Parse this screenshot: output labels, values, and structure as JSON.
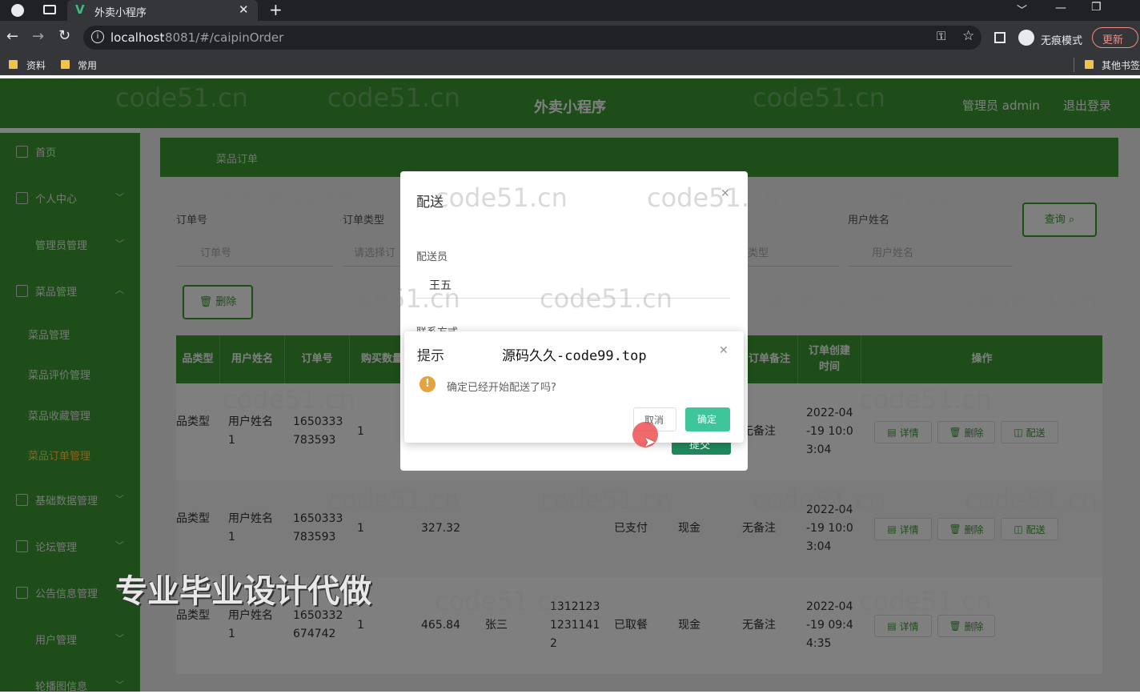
{
  "browser": {
    "tab_title": "外卖小程序",
    "new_tab_label": "+",
    "url_host": "localhost",
    "url_path": ":8081/#/caipinOrder",
    "incognito_label": "无痕模式",
    "update_label": "更新",
    "bookmarks": [
      "资料",
      "常用"
    ],
    "other_bookmarks": "其他书签"
  },
  "header": {
    "title": "外卖小程序",
    "user_label": "管理员 admin",
    "logout_label": "退出登录"
  },
  "sidebar": {
    "items": [
      {
        "label": "首页",
        "chevron": ""
      },
      {
        "label": "个人中心",
        "chevron": "﹀"
      },
      {
        "label": "管理员管理",
        "chevron": "﹀"
      },
      {
        "label": "菜品管理",
        "chevron": "︿"
      }
    ],
    "subitems": [
      "菜品管理",
      "菜品评价管理",
      "菜品收藏管理",
      "菜品订单管理"
    ],
    "items2": [
      {
        "label": "基础数据管理",
        "chevron": "﹀"
      },
      {
        "label": "论坛管理",
        "chevron": "﹀"
      },
      {
        "label": "公告信息管理",
        "chevron": "﹀"
      },
      {
        "label": "用户管理",
        "chevron": "﹀"
      },
      {
        "label": "轮播图信息",
        "chevron": "﹀"
      }
    ]
  },
  "breadcrumb": "菜品订单",
  "filters": {
    "order_no_label": "订单号",
    "order_no_placeholder": "订单号",
    "order_type_label": "订单类型",
    "order_type_placeholder": "请选择订",
    "pay_type_placeholder": "类型",
    "user_name_label": "用户姓名",
    "user_name_placeholder": "用户姓名",
    "search_button": "查询",
    "delete_button": "删除"
  },
  "table": {
    "columns": [
      "品类型",
      "用户姓名",
      "订单号",
      "购买数量",
      "订单备注",
      "订单创建\n时间",
      "操作"
    ],
    "rows": [
      {
        "type": "品类型",
        "user": "用户姓名\n1",
        "order_no": "1650333\n783593",
        "qty": "1",
        "price": "",
        "deliverer": "",
        "phone": "",
        "status": "",
        "pay": "",
        "remark": "无备注",
        "created": "2022-04\n-19 10:0\n3:04",
        "actions": [
          "详情",
          "删除",
          "配送"
        ]
      },
      {
        "type": "品类型",
        "user": "用户姓名\n1",
        "order_no": "1650333\n783593",
        "qty": "1",
        "price": "327.32",
        "deliverer": "",
        "phone": "",
        "status": "已支付",
        "pay": "现金",
        "remark": "无备注",
        "created": "2022-04\n-19 10:0\n3:04",
        "actions": [
          "详情",
          "删除",
          "配送"
        ]
      },
      {
        "type": "品类型",
        "user": "用户姓名\n1",
        "order_no": "1650332\n674742",
        "qty": "1",
        "price": "465.84",
        "deliverer": "张三",
        "phone": "1312123\n1231141\n2",
        "status": "已取餐",
        "pay": "现金",
        "remark": "无备注",
        "created": "2022-04\n-19 09:4\n4:35",
        "actions": [
          "详情",
          "删除"
        ]
      }
    ]
  },
  "delivery_dialog": {
    "title": "配送",
    "deliverer_label": "配送员",
    "deliverer_value": "王五",
    "contact_label": "联系方式",
    "confirm_label": "提交"
  },
  "message_box": {
    "title": "提示",
    "promo_text": "源码久久-code99.top",
    "message": "确定已经开始配送了吗?",
    "cancel_label": "取消",
    "confirm_label": "确定"
  },
  "overlay_caption": "专业毕业设计代做",
  "watermark": "code51.cn",
  "colors": {
    "brand_green": "#3c9a35",
    "confirm_teal": "#3ec69a",
    "warning": "#e6a23c"
  }
}
